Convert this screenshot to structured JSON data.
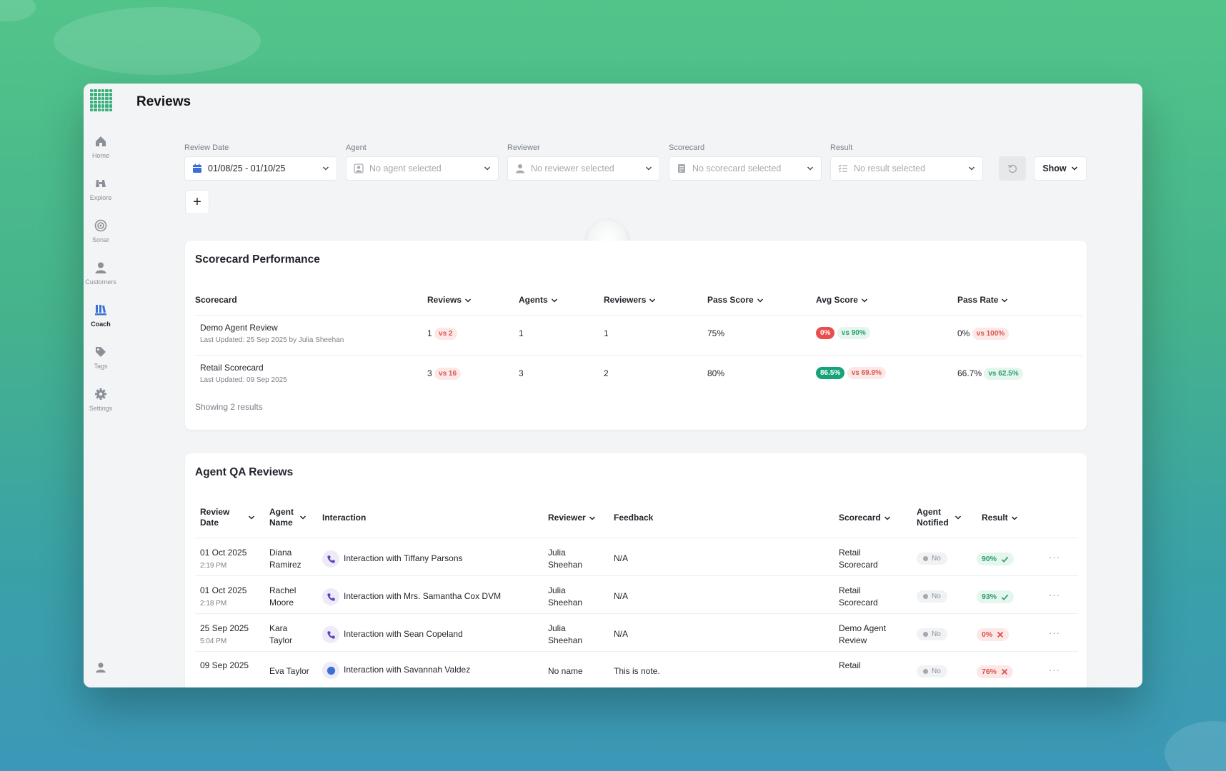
{
  "app": {
    "title": "Reviews"
  },
  "nav": [
    {
      "label": "Home",
      "icon": "home-icon"
    },
    {
      "label": "Explore",
      "icon": "binoculars-icon"
    },
    {
      "label": "Sonar",
      "icon": "sonar-icon"
    },
    {
      "label": "Customers",
      "icon": "user-icon"
    },
    {
      "label": "Coach",
      "icon": "coach-icon"
    },
    {
      "label": "Tags",
      "icon": "tag-icon"
    },
    {
      "label": "Settings",
      "icon": "gear-icon"
    }
  ],
  "filters": {
    "review_date": {
      "label": "Review Date",
      "value": "01/08/25 - 01/10/25"
    },
    "agent": {
      "label": "Agent",
      "placeholder": "No agent selected"
    },
    "reviewer": {
      "label": "Reviewer",
      "placeholder": "No reviewer selected"
    },
    "scorecard": {
      "label": "Scorecard",
      "placeholder": "No scorecard selected"
    },
    "result": {
      "label": "Result",
      "placeholder": "No result selected"
    },
    "show_label": "Show",
    "add_label": "+"
  },
  "scorecard_performance": {
    "title": "Scorecard Performance",
    "headers": [
      "Scorecard",
      "Reviews",
      "Agents",
      "Reviewers",
      "Pass Score",
      "Avg Score",
      "Pass Rate"
    ],
    "rows": [
      {
        "name": "Demo Agent Review",
        "updated": "Last Updated: 25 Sep 2025 by Julia Sheehan",
        "reviews": "1",
        "reviews_vs": "vs 2",
        "agents": "1",
        "reviewers": "1",
        "pass_score": "75%",
        "avg_score": "0%",
        "avg_vs": "vs 90%",
        "pass_rate": "0%",
        "pass_rate_vs": "vs 100%"
      },
      {
        "name": "Retail Scorecard",
        "updated": "Last Updated: 09 Sep 2025",
        "reviews": "3",
        "reviews_vs": "vs 16",
        "agents": "3",
        "reviewers": "2",
        "pass_score": "80%",
        "avg_score": "86.5%",
        "avg_vs": "vs 69.9%",
        "pass_rate": "66.7%",
        "pass_rate_vs": "vs 62.5%"
      }
    ],
    "footer": "Showing 2 results"
  },
  "agent_qa": {
    "title": "Agent QA Reviews",
    "headers": {
      "review_date": [
        "Review",
        "Date"
      ],
      "agent_name": [
        "Agent",
        "Name"
      ],
      "interaction": "Interaction",
      "reviewer": "Reviewer",
      "feedback": "Feedback",
      "scorecard": "Scorecard",
      "agent_notified": [
        "Agent",
        "Notified"
      ],
      "result": "Result"
    },
    "rows": [
      {
        "date": "01 Oct 2025",
        "time": "2:19 PM",
        "agent1": "Diana",
        "agent2": "Ramirez",
        "interaction": "Interaction with Tiffany Parsons",
        "reviewer1": "Julia",
        "reviewer2": "Sheehan",
        "feedback": "N/A",
        "scorecard1": "Retail",
        "scorecard2": "Scorecard",
        "notified": "No",
        "result": "90%",
        "pass": true
      },
      {
        "date": "01 Oct 2025",
        "time": "2:18 PM",
        "agent1": "Rachel",
        "agent2": "Moore",
        "interaction": "Interaction with Mrs. Samantha Cox DVM",
        "reviewer1": "Julia",
        "reviewer2": "Sheehan",
        "feedback": "N/A",
        "scorecard1": "Retail",
        "scorecard2": "Scorecard",
        "notified": "No",
        "result": "93%",
        "pass": true
      },
      {
        "date": "25 Sep 2025",
        "time": "5:04 PM",
        "agent1": "Kara",
        "agent2": "Taylor",
        "interaction": "Interaction with Sean Copeland",
        "reviewer1": "Julia",
        "reviewer2": "Sheehan",
        "feedback": "N/A",
        "scorecard1": "Demo Agent",
        "scorecard2": "Review",
        "notified": "No",
        "result": "0%",
        "pass": false
      },
      {
        "date": "09 Sep 2025",
        "time": "",
        "agent1": "Eva Taylor",
        "agent2": "",
        "interaction": "Interaction with Savannah Valdez",
        "reviewer1": "No name",
        "reviewer2": "",
        "feedback": "This is note.",
        "scorecard1": "Retail",
        "scorecard2": "",
        "notified": "No",
        "result": "76%",
        "pass": false
      }
    ]
  },
  "colors": {
    "accent": "#16a37a",
    "danger": "#ea4d4d",
    "brand": "#3cb07c"
  }
}
